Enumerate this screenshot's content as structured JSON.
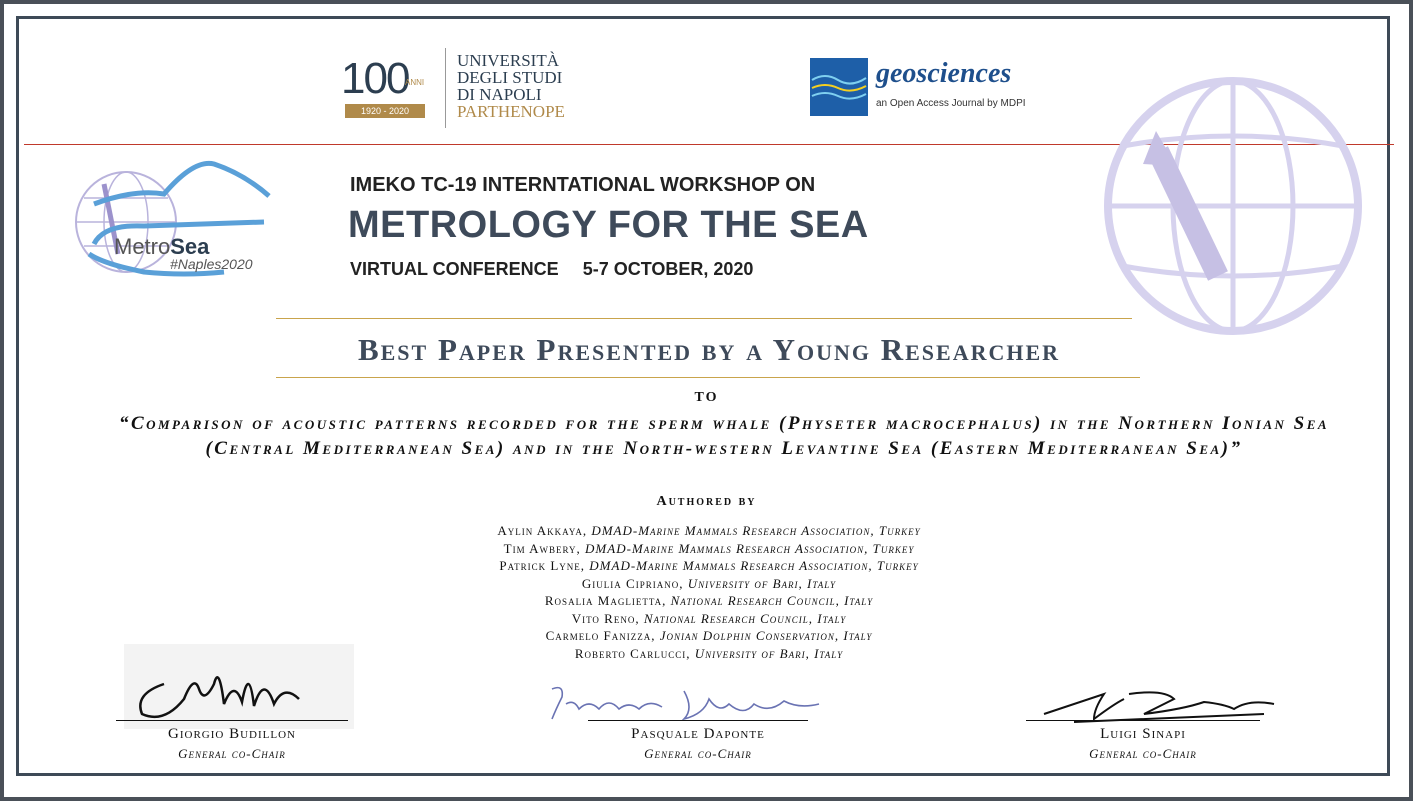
{
  "university": {
    "anniversary_number": "100",
    "anniversary_word": "ANNI",
    "years": "1920 - 2020",
    "name_lines": [
      "UNIVERSITÀ",
      "DEGLI STUDI",
      "DI NAPOLI"
    ],
    "name_last": "PARTHENOPE"
  },
  "journal": {
    "name": "geosciences",
    "subtitle": "an Open Access Journal by MDPI"
  },
  "workshop_logo": {
    "brand_light": "Metro",
    "brand_bold": "Sea",
    "tag": "#Naples2020"
  },
  "conference": {
    "line1": "IMEKO TC-19 INTERNTATIONAL WORKSHOP ON",
    "title": "METROLOGY FOR THE SEA",
    "format": "VIRTUAL CONFERENCE",
    "dates": "5-7 OCTOBER, 2020"
  },
  "award": {
    "title": "Best Paper Presented by a Young Researcher",
    "to": "TO",
    "paper_title": "“Comparison of acoustic patterns recorded for the sperm whale (Physeter macrocephalus) in the Northern Ionian Sea (Central Mediterranean Sea) and in the North-western Levantine Sea (Eastern Mediterranean Sea)”",
    "authored_by": "Authored by"
  },
  "authors": [
    {
      "name": "Aylin Akkaya",
      "affiliation": "DMAD-Marine Mammals Research Association, Turkey"
    },
    {
      "name": "Tim Awbery",
      "affiliation": "DMAD-Marine Mammals Research Association, Turkey"
    },
    {
      "name": "Patrick Lyne",
      "affiliation": "DMAD-Marine Mammals Research Association, Turkey"
    },
    {
      "name": "Giulia Cipriano",
      "affiliation": "University of Bari, Italy"
    },
    {
      "name": "Rosalia Maglietta",
      "affiliation": "National Research Council, Italy"
    },
    {
      "name": "Vito Reno",
      "affiliation": "National Research Council, Italy"
    },
    {
      "name": "Carmelo Fanizza",
      "affiliation": "Jonian Dolphin Conservation, Italy"
    },
    {
      "name": "Roberto Carlucci",
      "affiliation": "University of Bari, Italy"
    }
  ],
  "signatories": [
    {
      "name": "Giorgio Budillon",
      "role": "General co-Chair",
      "signature": "GBudillon"
    },
    {
      "name": "Pasquale Daponte",
      "role": "General co-Chair",
      "signature": "Pasquale Daponte"
    },
    {
      "name": "Luigi Sinapi",
      "role": "General co-Chair",
      "signature": "L Sinapi"
    }
  ],
  "colors": {
    "frame": "#3e4a57",
    "accent_red": "#c0392b",
    "gold": "#c9a44c",
    "title_slate": "#3e4a5a"
  }
}
